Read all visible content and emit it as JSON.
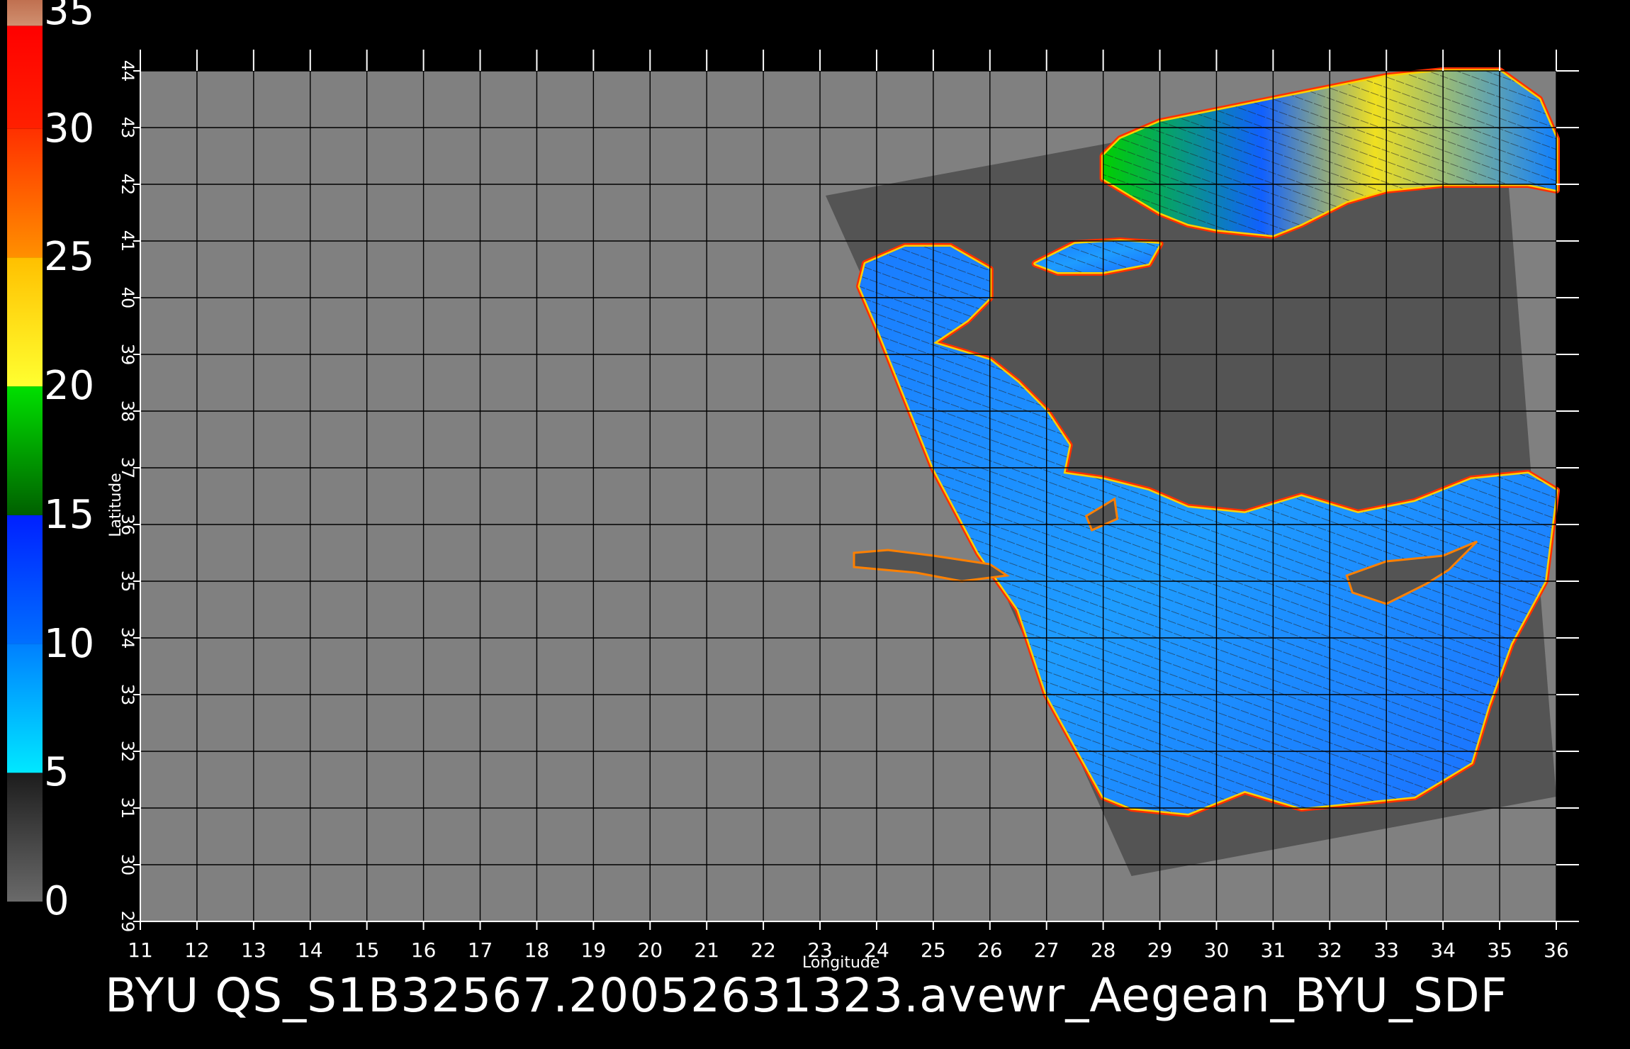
{
  "title": "BYU  QS_S1B32567.20052631323.avewr_Aegean_BYU_SDF",
  "colorbar": {
    "labels": [
      "35",
      "30",
      "25",
      "20",
      "15",
      "10",
      "5",
      "0"
    ],
    "segments": [
      {
        "from": 0,
        "to": 5,
        "colors": [
          "#6a6a6a",
          "#1c1c1c"
        ]
      },
      {
        "from": 5,
        "to": 10,
        "colors": [
          "#00e8ff",
          "#0080ff"
        ]
      },
      {
        "from": 10,
        "to": 15,
        "colors": [
          "#0070ff",
          "#0020ff"
        ]
      },
      {
        "from": 15,
        "to": 20,
        "colors": [
          "#006000",
          "#00e000"
        ]
      },
      {
        "from": 20,
        "to": 25,
        "colors": [
          "#ffff30",
          "#ffc000"
        ]
      },
      {
        "from": 25,
        "to": 30,
        "colors": [
          "#ff9000",
          "#ff3000"
        ]
      },
      {
        "from": 30,
        "to": 34,
        "colors": [
          "#ff2000",
          "#ff0000"
        ]
      },
      {
        "from": 34,
        "to": 35,
        "colors": [
          "#d09070",
          "#c07050"
        ]
      }
    ]
  },
  "map": {
    "xlabel": "Longitude",
    "ylabel": "Latitude",
    "lon_range": [
      11,
      36
    ],
    "lat_range": [
      29,
      44
    ],
    "lon_ticks": [
      "11",
      "12",
      "13",
      "14",
      "15",
      "16",
      "17",
      "18",
      "19",
      "20",
      "21",
      "22",
      "23",
      "24",
      "25",
      "26",
      "27",
      "28",
      "29",
      "30",
      "31",
      "32",
      "33",
      "34",
      "35",
      "36"
    ],
    "lat_ticks": [
      "29",
      "30",
      "31",
      "32",
      "33",
      "34",
      "35",
      "36",
      "37",
      "38",
      "39",
      "40",
      "41",
      "42",
      "43",
      "44"
    ],
    "colors": {
      "background": "#000000",
      "land_fill": "#808080",
      "swath_fill": "#545454",
      "grid": "#000000",
      "tick": "#ffffff"
    },
    "swath_corners": [
      [
        23.1,
        41.8
      ],
      [
        35.0,
        44.0
      ],
      [
        36.0,
        31.2
      ],
      [
        28.5,
        29.8
      ]
    ],
    "sea_regions": [
      {
        "name": "black-sea",
        "outline": [
          [
            28.0,
            42.5
          ],
          [
            28.3,
            42.8
          ],
          [
            29.0,
            43.1
          ],
          [
            30.0,
            43.3
          ],
          [
            31.0,
            43.5
          ],
          [
            32.0,
            43.7
          ],
          [
            33.0,
            43.9
          ],
          [
            34.0,
            44.0
          ],
          [
            35.0,
            44.0
          ],
          [
            35.7,
            43.5
          ],
          [
            36.0,
            42.8
          ],
          [
            36.0,
            41.9
          ],
          [
            35.5,
            42.0
          ],
          [
            34.8,
            42.0
          ],
          [
            34.0,
            42.0
          ],
          [
            33.0,
            41.9
          ],
          [
            32.3,
            41.7
          ],
          [
            31.5,
            41.3
          ],
          [
            31.0,
            41.1
          ],
          [
            30.0,
            41.2
          ],
          [
            29.5,
            41.3
          ],
          [
            29.0,
            41.5
          ],
          [
            28.5,
            41.8
          ],
          [
            28.0,
            42.1
          ]
        ]
      },
      {
        "name": "marmara-sea",
        "outline": [
          [
            26.8,
            40.6
          ],
          [
            27.5,
            40.95
          ],
          [
            28.3,
            41.0
          ],
          [
            29.0,
            40.95
          ],
          [
            28.8,
            40.6
          ],
          [
            28.0,
            40.45
          ],
          [
            27.2,
            40.45
          ]
        ]
      },
      {
        "name": "aegean-levantine",
        "outline": [
          [
            23.8,
            40.6
          ],
          [
            24.5,
            40.9
          ],
          [
            25.3,
            40.9
          ],
          [
            26.0,
            40.5
          ],
          [
            26.0,
            40.0
          ],
          [
            25.6,
            39.6
          ],
          [
            25.0,
            39.2
          ],
          [
            26.0,
            38.9
          ],
          [
            26.5,
            38.5
          ],
          [
            27.0,
            38.0
          ],
          [
            27.4,
            37.4
          ],
          [
            27.3,
            36.9
          ],
          [
            28.0,
            36.8
          ],
          [
            28.8,
            36.6
          ],
          [
            29.5,
            36.3
          ],
          [
            30.5,
            36.2
          ],
          [
            31.5,
            36.5
          ],
          [
            32.5,
            36.2
          ],
          [
            33.5,
            36.4
          ],
          [
            34.5,
            36.8
          ],
          [
            35.5,
            36.9
          ],
          [
            36.0,
            36.6
          ],
          [
            35.9,
            35.8
          ],
          [
            35.8,
            35.0
          ],
          [
            35.2,
            33.9
          ],
          [
            34.8,
            32.8
          ],
          [
            34.5,
            31.8
          ],
          [
            33.5,
            31.2
          ],
          [
            32.5,
            31.1
          ],
          [
            31.5,
            31.0
          ],
          [
            30.5,
            31.3
          ],
          [
            29.5,
            30.9
          ],
          [
            28.5,
            31.0
          ],
          [
            28.0,
            31.2
          ],
          [
            27.0,
            33.0
          ],
          [
            26.5,
            34.5
          ],
          [
            25.8,
            35.5
          ],
          [
            25.0,
            37.0
          ],
          [
            24.4,
            38.5
          ],
          [
            24.0,
            39.5
          ],
          [
            23.7,
            40.2
          ]
        ]
      }
    ],
    "land_in_sea": [
      {
        "name": "cyprus",
        "outline": [
          [
            32.3,
            35.1
          ],
          [
            33.0,
            35.35
          ],
          [
            34.0,
            35.45
          ],
          [
            34.6,
            35.7
          ],
          [
            34.1,
            35.2
          ],
          [
            33.7,
            34.95
          ],
          [
            33.0,
            34.6
          ],
          [
            32.4,
            34.8
          ]
        ]
      },
      {
        "name": "crete",
        "outline": [
          [
            23.6,
            35.5
          ],
          [
            24.2,
            35.55
          ],
          [
            25.0,
            35.45
          ],
          [
            26.0,
            35.3
          ],
          [
            26.3,
            35.1
          ],
          [
            25.5,
            35.0
          ],
          [
            24.7,
            35.15
          ],
          [
            23.6,
            35.25
          ]
        ]
      },
      {
        "name": "rhodes",
        "outline": [
          [
            27.7,
            36.15
          ],
          [
            28.2,
            36.45
          ],
          [
            28.25,
            36.1
          ],
          [
            27.8,
            35.9
          ]
        ]
      }
    ]
  }
}
